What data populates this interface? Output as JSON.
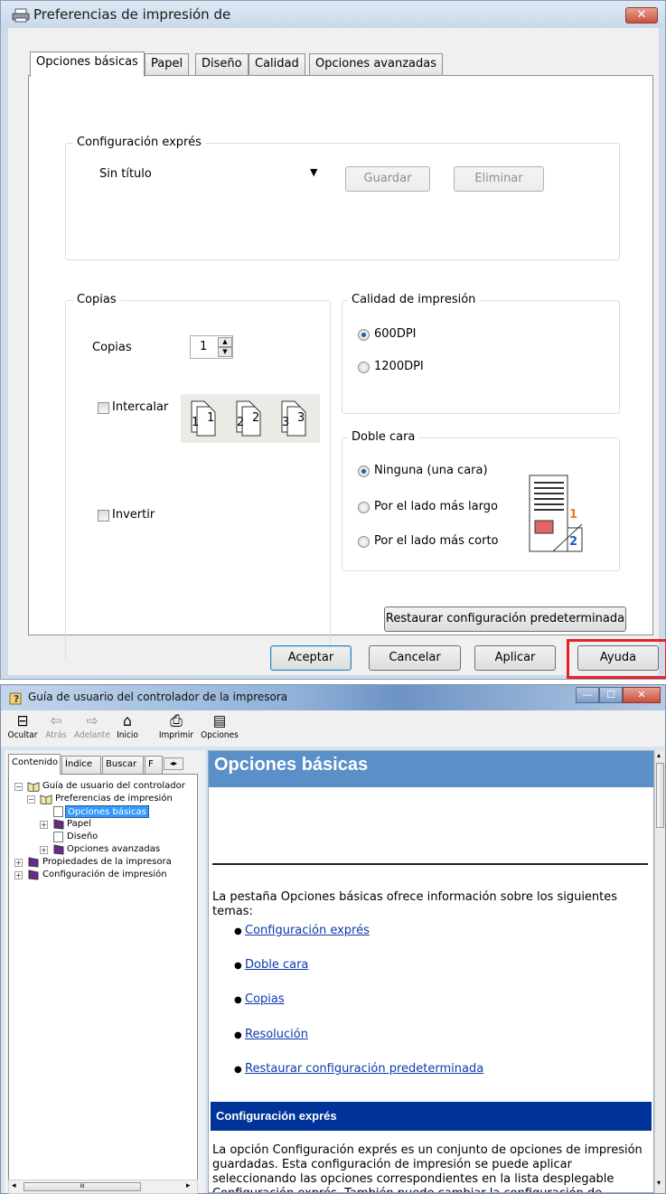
{
  "dialog1": {
    "title": "Preferencias de impresión de",
    "close_glyph": "✕",
    "tabs": [
      "Opciones básicas",
      "Papel",
      "Diseño",
      "Calidad",
      "Opciones avanzadas"
    ],
    "express": {
      "legend": "Configuración exprés",
      "select_value": "Sin título",
      "save": "Guardar",
      "delete": "Eliminar"
    },
    "copies": {
      "legend": "Copias",
      "label": "Copias",
      "value": "1",
      "collate": "Intercalar",
      "reverse": "Invertir",
      "collate_pages": [
        "1",
        "1",
        "2",
        "2",
        "3",
        "3"
      ]
    },
    "quality": {
      "legend": "Calidad de impresión",
      "options": [
        "600DPI",
        "1200DPI"
      ],
      "selected": "600DPI"
    },
    "duplex": {
      "legend": "Doble cara",
      "options": [
        "Ninguna (una cara)",
        "Por el lado más largo",
        "Por el lado más corto"
      ],
      "selected": "Ninguna (una cara)",
      "preview_numbers": [
        "1",
        "2"
      ]
    },
    "restore": "Restaurar configuración predeterminada",
    "buttons": {
      "ok": "Aceptar",
      "cancel": "Cancelar",
      "apply": "Aplicar",
      "help": "Ayuda"
    },
    "colors": {
      "highlight": "#e8202a"
    }
  },
  "window2": {
    "title": "Guía de usuario del controlador de la impresora",
    "caption": {
      "min": "—",
      "max": "☐",
      "close": "✕"
    },
    "toolbar": [
      {
        "label": "Ocultar",
        "icon": "hide-pane-icon",
        "glyph": "⊟"
      },
      {
        "label": "Atrás",
        "icon": "back-icon",
        "glyph": "⇦"
      },
      {
        "label": "Adelante",
        "icon": "forward-icon",
        "glyph": "⇨"
      },
      {
        "label": "Inicio",
        "icon": "home-icon",
        "glyph": "⌂"
      },
      {
        "label": "Imprimir",
        "icon": "print-icon",
        "glyph": "⎙"
      },
      {
        "label": "Opciones",
        "icon": "options-icon",
        "glyph": "▤"
      }
    ],
    "nav_tabs": [
      "Contenido",
      "Índice",
      "Buscar",
      "F"
    ],
    "tree": [
      "Guía de usuario del controlador",
      "Preferencias de impresión",
      "Opciones básicas",
      "Papel",
      "Diseño",
      "Opciones avanzadas",
      "Propiedades de la impresora",
      "Configuración de impresión"
    ],
    "hscroll_glyph": "III",
    "content": {
      "heading": "Opciones básicas",
      "intro": "La pestaña Opciones básicas ofrece información sobre los siguientes temas:",
      "links": [
        "Configuración exprés",
        "Doble cara",
        "Copias",
        "Resolución",
        "Restaurar configuración predeterminada"
      ],
      "section_title": "Configuración exprés",
      "section_text": " La opción Configuración exprés es un conjunto de opciones de impresión guardadas. Esta configuración de impresión se puede aplicar seleccionando las opciones correspondientes en la lista desplegable Configuración exprés. También puede cambiar la configuración de"
    }
  }
}
